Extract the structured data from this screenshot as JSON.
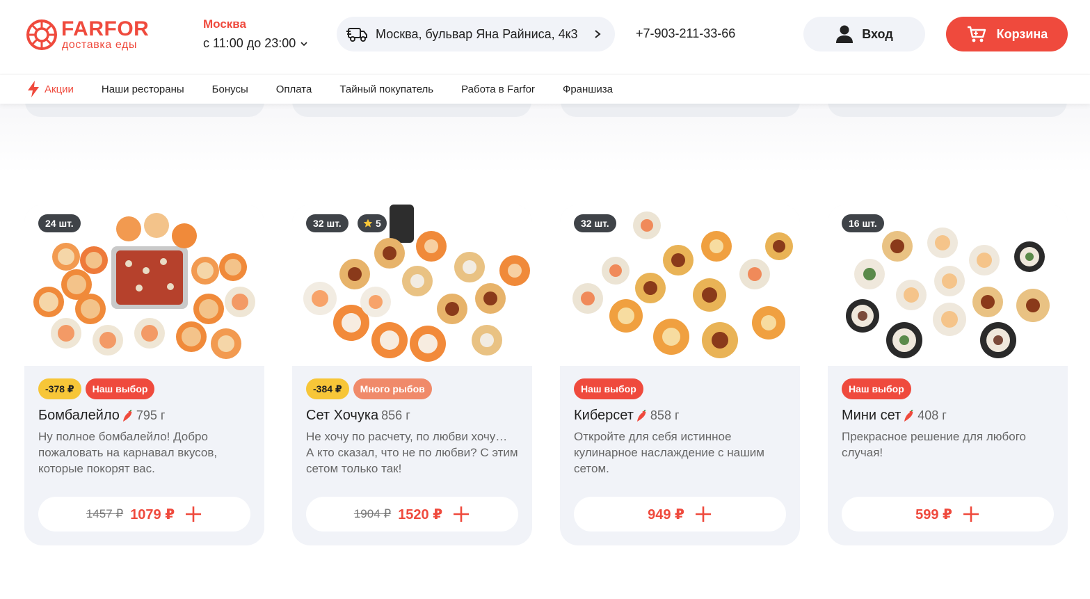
{
  "brand": {
    "name": "FARFOR",
    "tagline": "доставка еды",
    "color": "#ef4a3d"
  },
  "location": {
    "city": "Москва",
    "hours": "с 11:00 до 23:00"
  },
  "address": "Москва, бульвар Яна Райниса, 4к3",
  "phone": "+7-903-211-33-66",
  "header": {
    "login_label": "Вход",
    "cart_label": "Корзина"
  },
  "nav": [
    {
      "label": "Акции",
      "icon": "lightning-icon"
    },
    {
      "label": "Наши рестораны"
    },
    {
      "label": "Бонусы"
    },
    {
      "label": "Оплата"
    },
    {
      "label": "Тайный покупатель"
    },
    {
      "label": "Работа в Farfor"
    },
    {
      "label": "Франшиза"
    }
  ],
  "products": [
    {
      "qty": "24 шт.",
      "badges": [
        {
          "text": "-378 ₽",
          "kind": "discount"
        },
        {
          "text": "Наш выбор",
          "kind": "choice"
        }
      ],
      "name": "Бомбалейло",
      "spicy": true,
      "weight": "795 г",
      "description": "Ну полное бомбалейло! Добро пожаловать на карнавал вкусов, которые покорят вас.",
      "old_price": "1457 ₽",
      "price": "1079 ₽"
    },
    {
      "qty": "32 шт.",
      "rating": "5",
      "badges": [
        {
          "text": "-384 ₽",
          "kind": "discount"
        },
        {
          "text": "Много рыбов",
          "kind": "fish"
        }
      ],
      "name": "Сет Хочука",
      "spicy": false,
      "weight": "856 г",
      "description": "Не хочу по расчету, по любви хочу… А кто сказал, что не по любви? С этим сетом только так!",
      "old_price": "1904 ₽",
      "price": "1520 ₽"
    },
    {
      "qty": "32 шт.",
      "badges": [
        {
          "text": "Наш выбор",
          "kind": "choice"
        }
      ],
      "name": "Киберсет",
      "spicy": true,
      "weight": "858 г",
      "description": "Откройте для себя истинное кулинарное наслаждение с нашим сетом.",
      "price": "949 ₽"
    },
    {
      "qty": "16 шт.",
      "badges": [
        {
          "text": "Наш выбор",
          "kind": "choice"
        }
      ],
      "name": "Мини сет",
      "spicy": true,
      "weight": "408 г",
      "description": "Прекрасное решение для любого случая!",
      "price": "599 ₽"
    }
  ]
}
